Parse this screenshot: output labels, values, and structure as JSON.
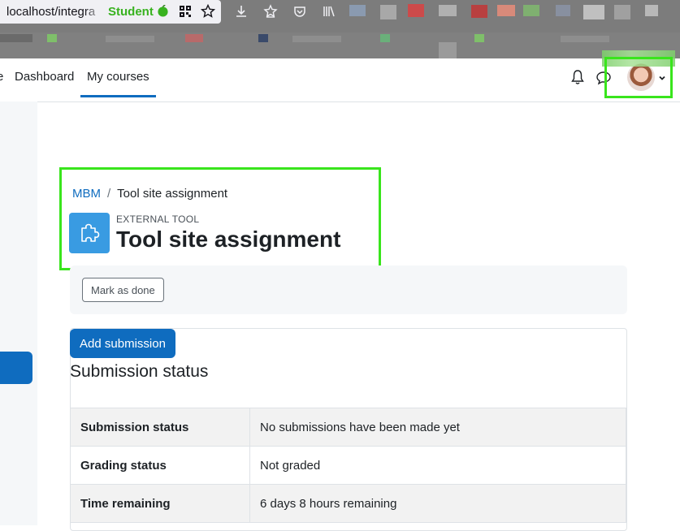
{
  "browser": {
    "url": "localhost/integra",
    "container_label": "Student"
  },
  "nav": {
    "partial_item": "e",
    "dashboard": "Dashboard",
    "my_courses": "My courses"
  },
  "breadcrumb": {
    "course": "MBM",
    "separator": "/",
    "current": "Tool site assignment"
  },
  "header": {
    "module_type": "EXTERNAL TOOL",
    "title": "Tool site assignment"
  },
  "completion": {
    "mark_done_label": "Mark as done"
  },
  "submission": {
    "add_button_label": "Add submission",
    "section_title": "Submission status",
    "rows": [
      {
        "key": "Submission status",
        "value": "No submissions have been made yet"
      },
      {
        "key": "Grading status",
        "value": "Not graded"
      },
      {
        "key": "Time remaining",
        "value": "6 days 8 hours remaining"
      }
    ]
  },
  "colors": {
    "primary": "#0f6cbf",
    "highlight": "#39e51c",
    "module_icon_bg": "#399be2",
    "container_green": "#38b21f"
  },
  "icons": [
    "apple-icon",
    "qr-code-icon",
    "star-icon",
    "download-icon",
    "extensions-icon",
    "pocket-icon",
    "library-icon",
    "bell-icon",
    "chat-icon",
    "chevron-down-icon",
    "puzzle-icon"
  ]
}
